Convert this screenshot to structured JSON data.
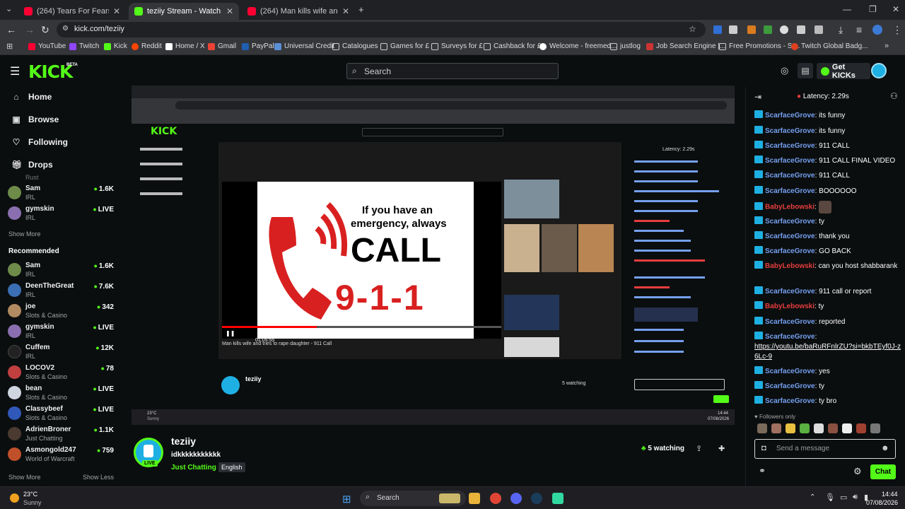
{
  "browser": {
    "tabs": [
      {
        "title": "(264) Tears For Fears - Shout (O",
        "favicon_color": "#ff0033"
      },
      {
        "title": "teziiy Stream - Watch Live on Ki",
        "favicon_color": "#53fc18"
      },
      {
        "title": "(264) Man kills wife and trie",
        "favicon_color": "#ff0033"
      }
    ],
    "url": "kick.com/teziiy",
    "bookmarks": [
      "YouTube",
      "Twitch",
      "Kick",
      "Reddit",
      "Home / X",
      "Gmail",
      "PayPal",
      "Universal Credit",
      "Catalogues",
      "Games for £",
      "Surveys for £",
      "Cashback for £",
      "Welcome - freemed...",
      "justlog",
      "Job Search Engine |...",
      "Free Promotions - St...",
      "Twitch Global Badg..."
    ]
  },
  "header": {
    "logo": "KICK",
    "logo_badge": "BETA",
    "search_placeholder": "Search",
    "get_kicks_label": "Get KICKs"
  },
  "sidebar": {
    "nav": [
      {
        "label": "Home",
        "icon": "home-icon"
      },
      {
        "label": "Browse",
        "icon": "browse-icon"
      },
      {
        "label": "Following",
        "icon": "heart-icon"
      },
      {
        "label": "Drops",
        "icon": "drops-icon"
      }
    ],
    "following_partial_category": "Rust",
    "following": [
      {
        "name": "Sam",
        "category": "IRL",
        "viewers": "1.6K",
        "color": "#6e8b4a"
      },
      {
        "name": "gymskin",
        "category": "IRL",
        "viewers": "LIVE",
        "color": "#8a6fb0"
      }
    ],
    "show_more_1": "Show More",
    "recommended_title": "Recommended",
    "recommended": [
      {
        "name": "Sam",
        "category": "IRL",
        "viewers": "1.6K",
        "color": "#6e8b4a"
      },
      {
        "name": "DeenTheGreat",
        "category": "IRL",
        "viewers": "7.6K",
        "color": "#3a6fb3"
      },
      {
        "name": "joe",
        "category": "Slots & Casino",
        "viewers": "342",
        "color": "#b08a60"
      },
      {
        "name": "gymskin",
        "category": "IRL",
        "viewers": "LIVE",
        "color": "#8a6fb0"
      },
      {
        "name": "Cuffem",
        "category": "IRL",
        "viewers": "12K",
        "color": "#222"
      },
      {
        "name": "LOCOV2",
        "category": "Slots & Casino",
        "viewers": "78",
        "color": "#c04040"
      },
      {
        "name": "bean",
        "category": "Slots & Casino",
        "viewers": "LIVE",
        "color": "#cfd6e0"
      },
      {
        "name": "Classybeef",
        "category": "Slots & Casino",
        "viewers": "LIVE",
        "color": "#2f58b8"
      },
      {
        "name": "AdrienBroner",
        "category": "Just Chatting",
        "viewers": "1.1K",
        "color": "#4a3a30"
      },
      {
        "name": "Asmongold247",
        "category": "World of Warcraft",
        "viewers": "759",
        "color": "#c0502a"
      }
    ],
    "show_more_2": "Show More",
    "show_less": "Show Less"
  },
  "video": {
    "headline_line1": "If you have an",
    "headline_line2": "emergency, always",
    "headline_call": "CALL",
    "headline_number": "9-1-1",
    "video_title": "Man kills wife and tries to rape daughter - 911 Call",
    "time": "01:05:55",
    "live": "LIVE",
    "latency": "Latency: 2.29s",
    "inner_streamer": "teziiy",
    "inner_watching": "5 watching",
    "inner_temp": "23°C",
    "inner_weather": "Sunny",
    "inner_time": "14:44",
    "inner_date": "07/08/2026"
  },
  "stream": {
    "name": "teziiy",
    "title": "idkkkkkkkkkkk",
    "category": "Just Chatting",
    "language": "English",
    "watching": "5 watching",
    "live_badge": "LIVE"
  },
  "chat": {
    "latency": "Latency: 2.29s",
    "messages": [
      {
        "user": "ScarfaceGrove",
        "text": ": its funny",
        "type": "u1"
      },
      {
        "user": "ScarfaceGrove",
        "text": ": its funny",
        "type": "u1"
      },
      {
        "user": "ScarfaceGrove",
        "text": ": 911 CALL",
        "type": "u1"
      },
      {
        "user": "ScarfaceGrove",
        "text": ": 911 CALL FINAL VIDEO",
        "type": "u1"
      },
      {
        "user": "ScarfaceGrove",
        "text": ": 911 CALL",
        "type": "u1"
      },
      {
        "user": "ScarfaceGrove",
        "text": ": BOOOOOO",
        "type": "u1"
      },
      {
        "user": "BabyLebowski",
        "text": ":",
        "type": "u2"
      },
      {
        "user": "ScarfaceGrove",
        "text": ": ty",
        "type": "u1"
      },
      {
        "user": "ScarfaceGrove",
        "text": ": thank you",
        "type": "u1"
      },
      {
        "user": "ScarfaceGrove",
        "text": ": GO BACK",
        "type": "u1"
      },
      {
        "user": "BabyLebowski",
        "text": ": can you host shabbarank",
        "type": "u2"
      },
      {
        "user": "ScarfaceGrove",
        "text": ": 911 call or report",
        "type": "u1"
      },
      {
        "user": "BabyLebowski",
        "text": ": ty",
        "type": "u2"
      },
      {
        "user": "ScarfaceGrove",
        "text": ": reported",
        "type": "u1"
      },
      {
        "user": "ScarfaceGrove",
        "text": ":",
        "type": "u1"
      },
      {
        "user": "ScarfaceGrove",
        "text": ": yes",
        "type": "u1"
      },
      {
        "user": "ScarfaceGrove",
        "text": ": ty",
        "type": "u1"
      },
      {
        "user": "ScarfaceGrove",
        "text": ": ty bro",
        "type": "u1"
      }
    ],
    "link_text": "https://youtu.be/baRuRFnlrZU?si=bkbTEyf0J-z6Lc-9",
    "followers_only": "Followers only",
    "input_placeholder": "Send a message",
    "send_label": "Chat",
    "accent": "#53fc18"
  },
  "taskbar": {
    "temp": "23°C",
    "weather": "Sunny",
    "search": "Search",
    "time": "14:44",
    "date": "07/08/2026"
  }
}
